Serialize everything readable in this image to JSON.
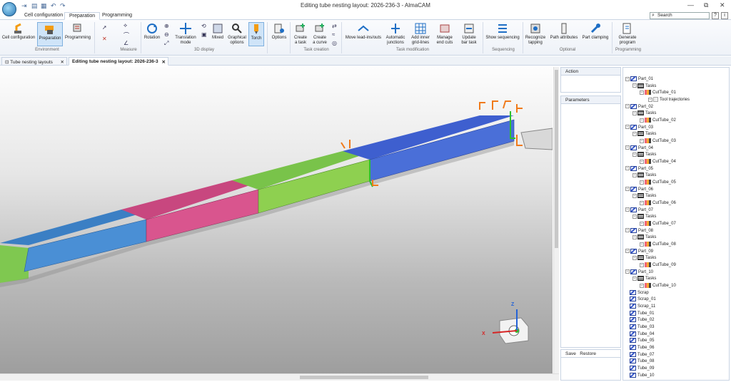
{
  "window": {
    "title": "Editing tube nesting layout: 2026-236-3 - AlmaCAM"
  },
  "ribbon_tabs": [
    "Cell configuration",
    "Preparation",
    "Programming"
  ],
  "search": {
    "placeholder": "Search"
  },
  "help": {
    "q": "?",
    "i": "i"
  },
  "ribbon": {
    "cell_configuration": "Cell configuration",
    "preparation": "Preparation",
    "programming": "Programming",
    "rotation": "Rotation",
    "translation_mode_1": "Translation",
    "translation_mode_2": "mode",
    "mixed": "Mixed",
    "graphical_options_1": "Graphical",
    "graphical_options_2": "options",
    "torch": "Torch",
    "options": "Options",
    "create_task_1": "Create",
    "create_task_2": "a task",
    "create_curve_1": "Create",
    "create_curve_2": "a curve",
    "move_lead": "Move lead-ins/outs",
    "auto_junctions_1": "Automatic",
    "auto_junctions_2": "junctions",
    "add_inner_1": "Add inner",
    "add_inner_2": "grid-lines",
    "manage_end_1": "Manage",
    "manage_end_2": "end cuts",
    "update_bar_1": "Update",
    "update_bar_2": "bar task",
    "show_sequencing": "Show sequencing",
    "recognize_tapping_1": "Recognize",
    "recognize_tapping_2": "tapping",
    "path_attributes": "Path attributes",
    "part_clamping": "Part clamping",
    "generate_program_1": "Generate",
    "generate_program_2": "program"
  },
  "groups": {
    "environment": "Environment",
    "measure": "Measure",
    "display3d": "3D display",
    "task_creation": "Task creation",
    "task_modification": "Task modification",
    "sequencing": "Sequencing",
    "optional": "Optional",
    "programming": "Programming"
  },
  "doc_tabs": [
    "Tube nesting layouts",
    "Editing tube nesting layout: 2026-236-3"
  ],
  "panels": {
    "action": "Action",
    "parameters": "Parameters",
    "save": "Save",
    "restore": "Restore"
  },
  "axes": {
    "z": "Z",
    "x": "X"
  },
  "tree": {
    "tasks_label": "Tasks",
    "tool_trajectories": "Tool trajectories",
    "parts": [
      "Part_01",
      "Part_02",
      "Part_03",
      "Part_04",
      "Part_05",
      "Part_06",
      "Part_07",
      "Part_08",
      "Part_09",
      "Part_10"
    ],
    "cuts": [
      "CutTube_01",
      "CutTube_02",
      "CutTube_03",
      "CutTube_04",
      "CutTube_05",
      "CutTube_06",
      "CutTube_07",
      "CutTube_08",
      "CutTube_09",
      "CutTube_10"
    ],
    "others": [
      "Scrap",
      "Scrap_01",
      "Scrap_11",
      "Tube_01",
      "Tube_02",
      "Tube_03",
      "Tube_04",
      "Tube_05",
      "Tube_06",
      "Tube_07",
      "Tube_08",
      "Tube_09",
      "Tube_10"
    ]
  },
  "colors": {
    "accent": "#1f6fc5",
    "tube_blue": "#4a6fd8",
    "tube_green": "#8ed050",
    "tube_pink": "#d9558e",
    "cut_orange": "#f07a1a"
  }
}
